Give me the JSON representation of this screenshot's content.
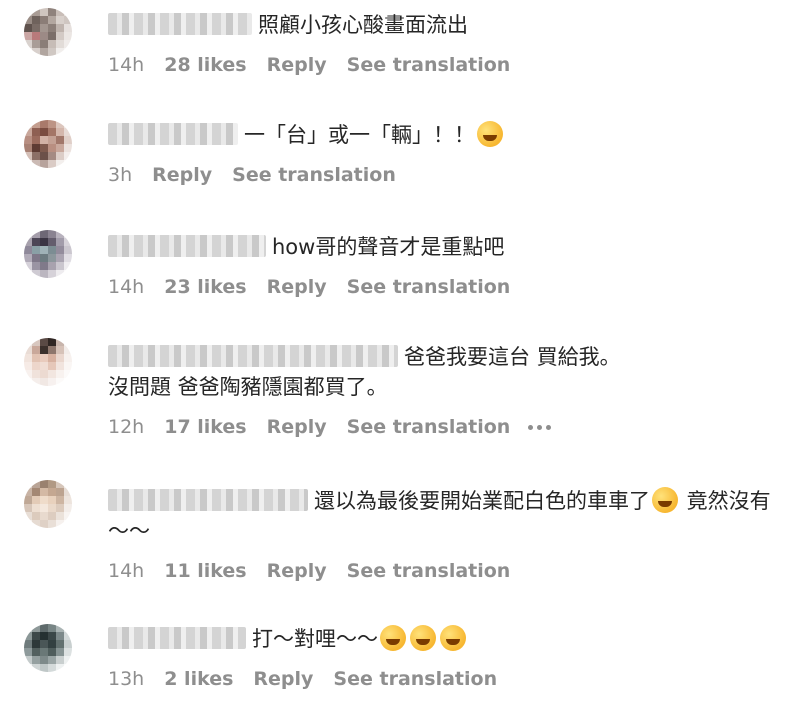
{
  "comments": [
    {
      "text": "照顧小孩心酸畫面流出",
      "time": "14h",
      "likes": "28 likes",
      "reply": "Reply",
      "translate": "See translation",
      "emoji": []
    },
    {
      "text": "一「台」或一「輛」！！",
      "time": "3h",
      "likes": "",
      "reply": "Reply",
      "translate": "See translation",
      "emoji": [
        "rofl-emoji"
      ]
    },
    {
      "text": "how哥的聲音才是重點吧",
      "time": "14h",
      "likes": "23 likes",
      "reply": "Reply",
      "translate": "See translation",
      "emoji": []
    },
    {
      "text": "爸爸我要這台 買給我。\n沒問題 爸爸陶豬隱園都買了。",
      "time": "12h",
      "likes": "17 likes",
      "reply": "Reply",
      "translate": "See translation",
      "emoji": []
    },
    {
      "text": "還以為最後要開始業配白色的車車了",
      "text2": " 竟然沒有～～",
      "time": "14h",
      "likes": "11 likes",
      "reply": "Reply",
      "translate": "See translation",
      "emoji": [
        "rofl-emoji"
      ]
    },
    {
      "text": "打～對哩～～",
      "time": "13h",
      "likes": "2 likes",
      "reply": "Reply",
      "translate": "See translation",
      "emoji": [
        "joy-emoji",
        "joy-emoji",
        "joy-emoji"
      ]
    }
  ],
  "colors": {
    "text": "#262626",
    "meta": "#8e8e8e"
  }
}
